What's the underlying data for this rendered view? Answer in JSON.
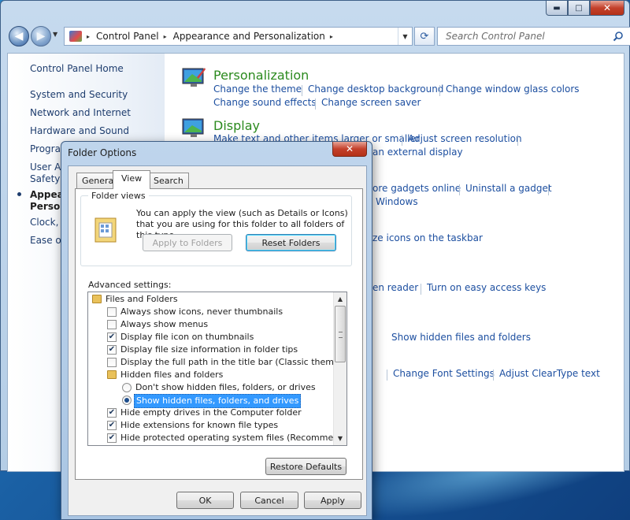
{
  "window": {
    "caption_buttons": {
      "minimize": "▬",
      "maximize": "□",
      "close": "✕"
    }
  },
  "navigation": {
    "back_glyph": "◀",
    "forward_glyph": "▶",
    "breadcrumbs": [
      "Control Panel",
      "Appearance and Personalization"
    ],
    "breadcrumb_separator": "▸",
    "refresh_glyph": "⟳",
    "search_placeholder": "Search Control Panel"
  },
  "left_pane": {
    "items": [
      {
        "label": "Control Panel Home"
      },
      {
        "label": "System and Security"
      },
      {
        "label": "Network and Internet"
      },
      {
        "label": "Hardware and Sound"
      },
      {
        "label": "Program"
      },
      {
        "label": "User Ac"
      },
      {
        "label": "Safety"
      },
      {
        "label": "Appear",
        "current": true
      },
      {
        "label": "Persona",
        "current": true
      },
      {
        "label": "Clock, L"
      },
      {
        "label": "Ease of"
      }
    ]
  },
  "categories": {
    "personalization": {
      "title": "Personalization",
      "links": [
        "Change the theme",
        "Change desktop background",
        "Change window glass colors",
        "Change sound effects",
        "Change screen saver"
      ]
    },
    "display": {
      "title": "Display",
      "links": [
        "Make text and other items larger or smaller",
        "Adjust screen resolution",
        "an external display"
      ]
    },
    "gadgets": {
      "links": [
        "ore gadgets online",
        "Uninstall a gadget",
        "Windows"
      ]
    },
    "taskbar": {
      "links": [
        "ze icons on the taskbar"
      ]
    },
    "ease_of_access": {
      "links": [
        "en reader",
        "Turn on easy access keys"
      ]
    },
    "folder_options": {
      "links": [
        "Show hidden files and folders"
      ]
    },
    "fonts": {
      "links": [
        "Change Font Settings",
        "Adjust ClearType text"
      ]
    }
  },
  "dialog": {
    "title": "Folder Options",
    "close_glyph": "✕",
    "tabs": [
      {
        "label": "General",
        "active": false
      },
      {
        "label": "View",
        "active": true
      },
      {
        "label": "Search",
        "active": false
      }
    ],
    "folder_views": {
      "group_label": "Folder views",
      "description": "You can apply the view (such as Details or Icons) that you are using for this folder to all folders of this type.",
      "apply_button": "Apply to Folders",
      "reset_button": "Reset Folders"
    },
    "advanced_label": "Advanced settings:",
    "advanced_items": [
      {
        "kind": "folder",
        "label": "Files and Folders",
        "level": 0
      },
      {
        "kind": "checkbox",
        "label": "Always show icons, never thumbnails",
        "checked": false,
        "level": 1
      },
      {
        "kind": "checkbox",
        "label": "Always show menus",
        "checked": false,
        "level": 1
      },
      {
        "kind": "checkbox",
        "label": "Display file icon on thumbnails",
        "checked": true,
        "level": 1
      },
      {
        "kind": "checkbox",
        "label": "Display file size information in folder tips",
        "checked": true,
        "level": 1
      },
      {
        "kind": "checkbox",
        "label": "Display the full path in the title bar (Classic theme only)",
        "checked": false,
        "level": 1
      },
      {
        "kind": "folder",
        "label": "Hidden files and folders",
        "level": 1
      },
      {
        "kind": "radio",
        "label": "Don't show hidden files, folders, or drives",
        "checked": false,
        "level": 2
      },
      {
        "kind": "radio",
        "label": "Show hidden files, folders, and drives",
        "checked": true,
        "selected": true,
        "level": 2
      },
      {
        "kind": "checkbox",
        "label": "Hide empty drives in the Computer folder",
        "checked": true,
        "level": 1
      },
      {
        "kind": "checkbox",
        "label": "Hide extensions for known file types",
        "checked": true,
        "level": 1
      },
      {
        "kind": "checkbox",
        "label": "Hide protected operating system files (Recommended)",
        "checked": true,
        "level": 1
      }
    ],
    "scroll_arrows": {
      "up": "▲",
      "down": "▼"
    },
    "check_glyph": "✔",
    "restore_button": "Restore Defaults",
    "ok_button": "OK",
    "cancel_button": "Cancel",
    "apply_button": "Apply"
  }
}
